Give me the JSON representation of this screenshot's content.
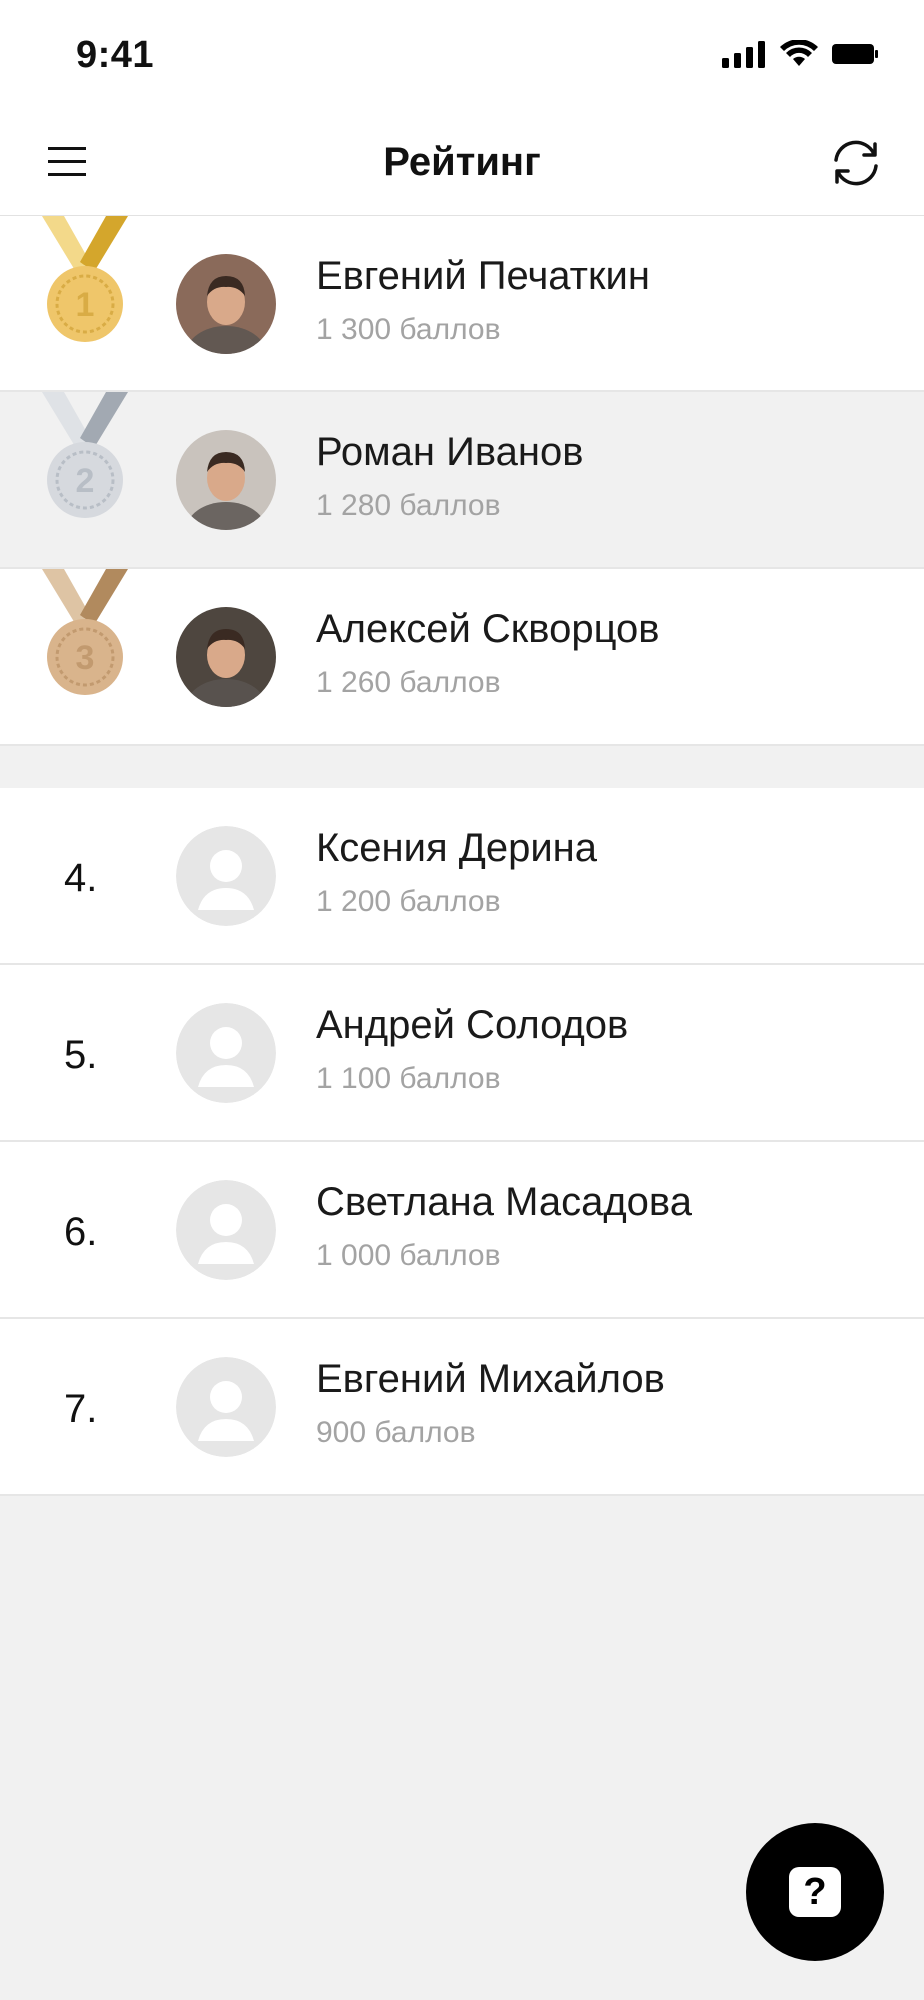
{
  "status_bar": {
    "time": "9:41"
  },
  "nav": {
    "title": "Рейтинг",
    "menu_icon": "hamburger-menu-icon",
    "refresh_icon": "refresh-icon"
  },
  "top_three": [
    {
      "place": "1",
      "name": "Евгений Печаткин",
      "score": "1 300 баллов",
      "medal": "gold",
      "ribbon": "#d4a62c",
      "ribbon_light": "#f3d98a",
      "disc": "#efc66a",
      "ring": "#d9ac45",
      "avatar_bg": "#8a6a5a",
      "highlighted": false
    },
    {
      "place": "2",
      "name": "Роман Иванов",
      "score": "1 280 баллов",
      "medal": "silver",
      "ribbon": "#a2a9b2",
      "ribbon_light": "#dfe2e6",
      "disc": "#d6d9de",
      "ring": "#b8bec6",
      "avatar_bg": "#c9c3bd",
      "highlighted": true
    },
    {
      "place": "3",
      "name": "Алексей Скворцов",
      "score": "1 260 баллов",
      "medal": "bronze",
      "ribbon": "#b18a5e",
      "ribbon_light": "#dec4a4",
      "disc": "#d9b48c",
      "ring": "#c29a6f",
      "avatar_bg": "#4e463f",
      "highlighted": false
    }
  ],
  "others": [
    {
      "rank": "4.",
      "name": "Ксения Дерина",
      "score": "1 200 баллов"
    },
    {
      "rank": "5.",
      "name": "Андрей Солодов",
      "score": "1 100 баллов"
    },
    {
      "rank": "6.",
      "name": "Светлана Масадова",
      "score": "1 000 баллов"
    },
    {
      "rank": "7.",
      "name": "Евгений Михайлов",
      "score": "900 баллов"
    }
  ],
  "help": {
    "label": "?",
    "icon": "help-icon"
  },
  "colors": {
    "background": "#f1f1f1",
    "score_text": "#a3a3a3",
    "placeholder_avatar": "#e6e6e6"
  }
}
